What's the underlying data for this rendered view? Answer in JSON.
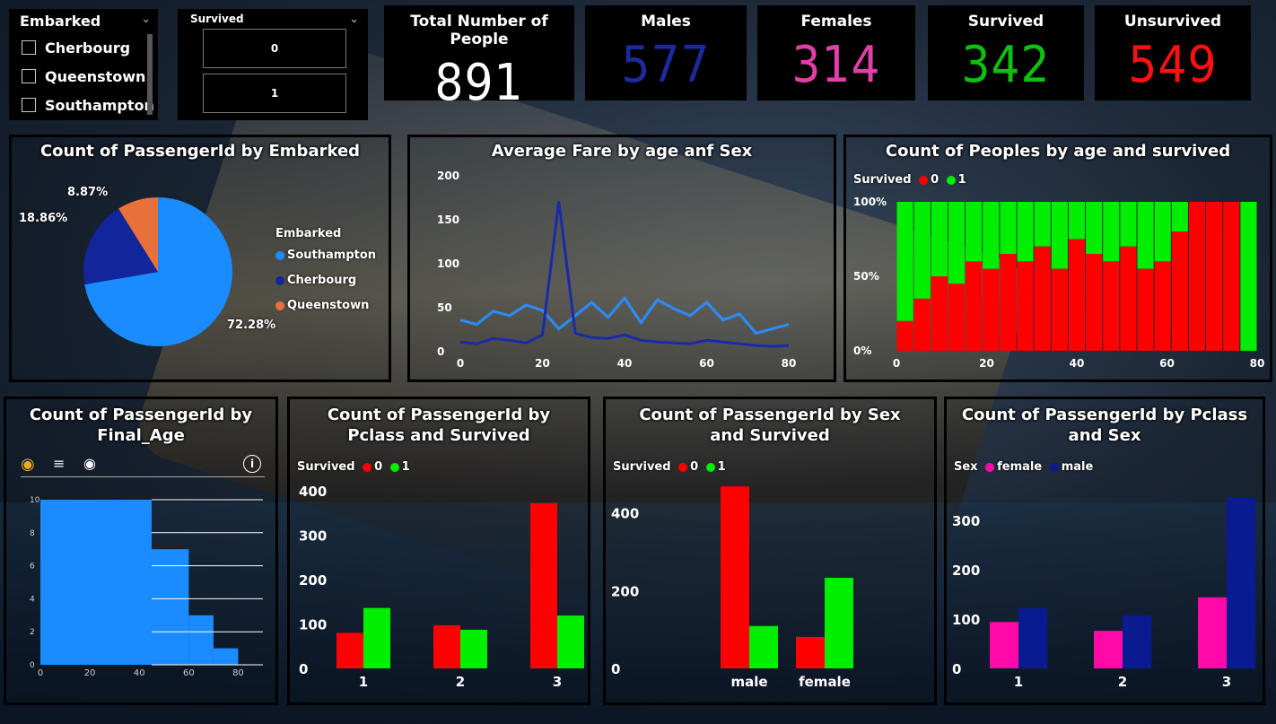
{
  "slicer_embarked": {
    "title": "Embarked",
    "items": [
      {
        "label": "Cherbourg"
      },
      {
        "label": "Queenstown"
      },
      {
        "label": "Southampton"
      }
    ]
  },
  "slicer_survived": {
    "title": "Survived",
    "options": [
      "0",
      "1"
    ]
  },
  "kpis": [
    {
      "title": "Total Number of People",
      "value": "891",
      "color": "#ffffff"
    },
    {
      "title": "Males",
      "value": "577",
      "color": "#1c2a9e"
    },
    {
      "title": "Females",
      "value": "314",
      "color": "#e040a8"
    },
    {
      "title": "Survived",
      "value": "342",
      "color": "#10c010"
    },
    {
      "title": "Unsurvived",
      "value": "549",
      "color": "#ff1010"
    }
  ],
  "panels": {
    "pie": {
      "title": "Count of PassengerId by Embarked",
      "legend_title": "Embarked",
      "legend": [
        "Southampton",
        "Cherbourg",
        "Queenstown"
      ],
      "labels": [
        "8.87%",
        "18.86%",
        "72.28%"
      ]
    },
    "fare": {
      "title": "Average Fare by age anf Sex"
    },
    "age_survived": {
      "title": "Count of Peoples by age and survived",
      "legend_title": "Survived",
      "legend": [
        "0",
        "1"
      ]
    },
    "final_age": {
      "title": "Count of PassengerId by Final_Age"
    },
    "pclass_survived": {
      "title": "Count of PassengerId by Pclass and Survived",
      "legend_title": "Survived",
      "legend": [
        "0",
        "1"
      ]
    },
    "sex_survived": {
      "title": "Count of PassengerId by Sex and Survived",
      "legend_title": "Survived",
      "legend": [
        "0",
        "1"
      ]
    },
    "pclass_sex": {
      "title": "Count of PassengerId by Pclass and Sex",
      "legend_title": "Sex",
      "legend": [
        "female",
        "male"
      ]
    }
  },
  "colors": {
    "survived_0": "#ff0000",
    "survived_1": "#00ee00",
    "female": "#ff0aa8",
    "male": "#0a1a90",
    "southampton": "#1a8cff",
    "cherbourg": "#12259a",
    "queenstown": "#e8703a"
  },
  "chart_data": [
    {
      "type": "pie",
      "categories": [
        "Southampton",
        "Cherbourg",
        "Queenstown"
      ],
      "values": [
        72.28,
        18.86,
        8.87
      ]
    },
    {
      "type": "line",
      "x": [
        0,
        4,
        8,
        12,
        16,
        20,
        24,
        28,
        32,
        36,
        40,
        44,
        48,
        52,
        56,
        60,
        64,
        68,
        72,
        76,
        80
      ],
      "series": [
        {
          "values": [
            35,
            30,
            45,
            40,
            52,
            46,
            25,
            40,
            55,
            38,
            60,
            32,
            58,
            48,
            40,
            55,
            35,
            42,
            20,
            25,
            30
          ]
        },
        {
          "values": [
            10,
            8,
            14,
            12,
            9,
            18,
            170,
            20,
            15,
            14,
            18,
            12,
            10,
            9,
            8,
            12,
            10,
            8,
            6,
            5,
            6
          ]
        }
      ],
      "ylim": [
        0,
        200
      ],
      "yticks": [
        0,
        50,
        100,
        150,
        200
      ],
      "xticks": [
        0,
        20,
        40,
        60,
        80
      ]
    },
    {
      "type": "bar",
      "stacked_percent": true,
      "x": [
        0,
        20,
        40,
        60,
        80
      ],
      "series": [
        {
          "name": "0",
          "values": [
            0.2,
            0.35,
            0.5,
            0.45,
            0.6,
            0.55,
            0.65,
            0.6,
            0.7,
            0.55,
            0.75,
            0.65,
            0.6,
            0.7,
            0.55,
            0.6,
            0.8,
            1,
            1,
            1,
            0
          ]
        },
        {
          "name": "1",
          "values": [
            0.8,
            0.65,
            0.5,
            0.55,
            0.4,
            0.45,
            0.35,
            0.4,
            0.3,
            0.45,
            0.25,
            0.35,
            0.4,
            0.3,
            0.45,
            0.4,
            0.2,
            0,
            0,
            0,
            1
          ]
        }
      ],
      "yticks": [
        "0%",
        "50%",
        "100%"
      ]
    },
    {
      "type": "bar",
      "yticks": [
        0,
        2,
        4,
        6,
        8,
        10
      ],
      "xticks": [
        0,
        20,
        40,
        60,
        80
      ],
      "steps": [
        {
          "x": 45,
          "y": 10
        },
        {
          "x": 60,
          "y": 7
        },
        {
          "x": 70,
          "y": 3
        },
        {
          "x": 80,
          "y": 1
        }
      ]
    },
    {
      "type": "bar",
      "categories": [
        "1",
        "2",
        "3"
      ],
      "series": [
        {
          "name": "0",
          "values": [
            80,
            97,
            372
          ]
        },
        {
          "name": "1",
          "values": [
            136,
            87,
            119
          ]
        }
      ],
      "ylim": [
        0,
        400
      ],
      "yticks": [
        0,
        100,
        200,
        300,
        400
      ]
    },
    {
      "type": "bar",
      "categories": [
        "male",
        "female"
      ],
      "series": [
        {
          "name": "0",
          "values": [
            468,
            81
          ]
        },
        {
          "name": "1",
          "values": [
            109,
            233
          ]
        }
      ],
      "ylim": [
        0,
        480
      ],
      "yticks": [
        0,
        200,
        400
      ]
    },
    {
      "type": "bar",
      "categories": [
        "1",
        "2",
        "3"
      ],
      "series": [
        {
          "name": "female",
          "values": [
            94,
            76,
            144
          ]
        },
        {
          "name": "male",
          "values": [
            122,
            108,
            347
          ]
        }
      ],
      "ylim": [
        0,
        360
      ],
      "yticks": [
        0,
        100,
        200,
        300
      ]
    }
  ]
}
